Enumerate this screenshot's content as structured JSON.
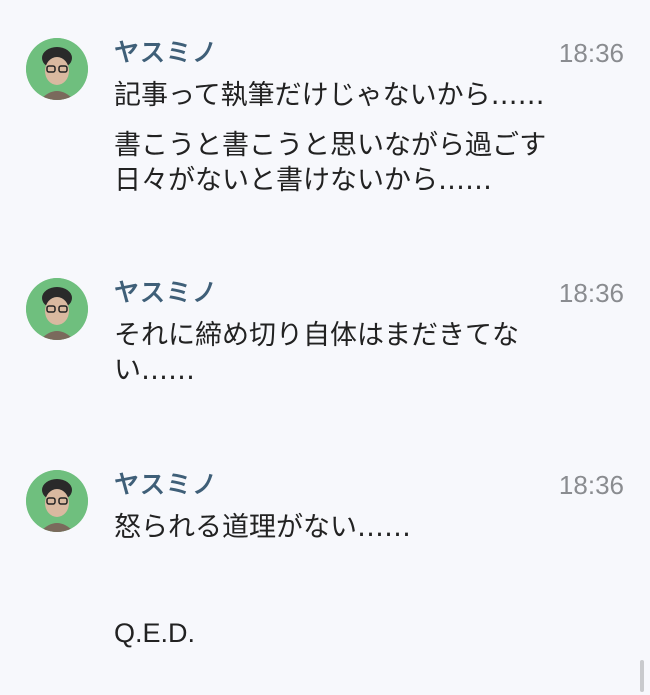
{
  "messages": [
    {
      "sender": "ヤスミノ",
      "time": "18:36",
      "paragraphs": [
        [
          "記事って執筆だけじゃないから……"
        ],
        [
          "書こうと書こうと思いながら過ごす",
          "日々がないと書けないから……"
        ]
      ]
    },
    {
      "sender": "ヤスミノ",
      "time": "18:36",
      "paragraphs": [
        [
          "それに締め切り自体はまだきてな",
          "い……"
        ]
      ]
    },
    {
      "sender": "ヤスミノ",
      "time": "18:36",
      "paragraphs": [
        [
          "怒られる道理がない……"
        ]
      ]
    }
  ],
  "trailing_message": "Q.E.D.",
  "colors": {
    "background": "#f7f8fc",
    "sender_name": "#3f5f78",
    "timestamp": "#8a8c90",
    "avatar_bg": "#6fbf7e"
  },
  "icons": {
    "avatar": "user-avatar-photo"
  }
}
